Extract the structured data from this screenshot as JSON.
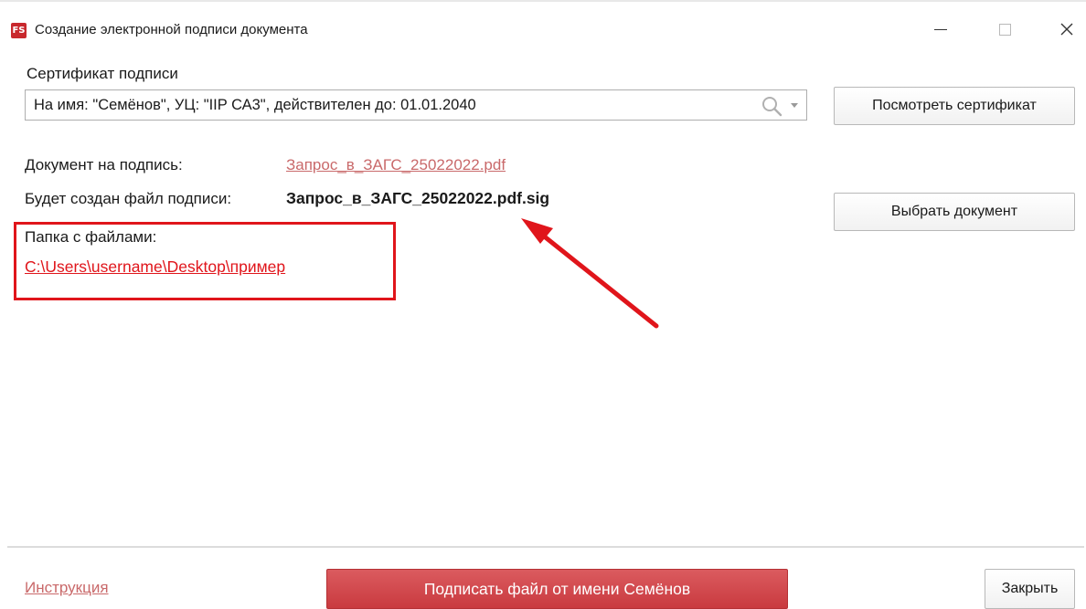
{
  "window": {
    "title": "Создание электронной подписи документа",
    "app_icon_text": "FS"
  },
  "certificate": {
    "label": "Сертификат подписи",
    "value": "На имя: \"Семёнов\", УЦ: \"IIP СА3\", действителен до: 01.01.2040",
    "view_button": "Посмотреть сертификат"
  },
  "document": {
    "label": "Документ на подпись:",
    "file": "Запрос_в_ЗАГС_25022022.pdf",
    "signature_label": "Будет создан файл подписи:",
    "signature_file": "Запрос_в_ЗАГС_25022022.pdf.sig",
    "choose_button": "Выбрать документ"
  },
  "folder": {
    "label": "Папка с файлами:",
    "path": "C:\\Users\\username\\Desktop\\пример"
  },
  "footer": {
    "help_link": "Инструкция",
    "sign_button": "Подписать файл от имени Семёнов",
    "close_button": "Закрыть"
  },
  "colors": {
    "accent": "#c93a3f",
    "annotation": "#e0151b",
    "link": "#c9696a"
  },
  "icons": [
    "app-logo-icon",
    "minimize-icon",
    "maximize-icon",
    "close-icon",
    "search-icon",
    "dropdown-arrow-icon",
    "annotation-arrow"
  ]
}
